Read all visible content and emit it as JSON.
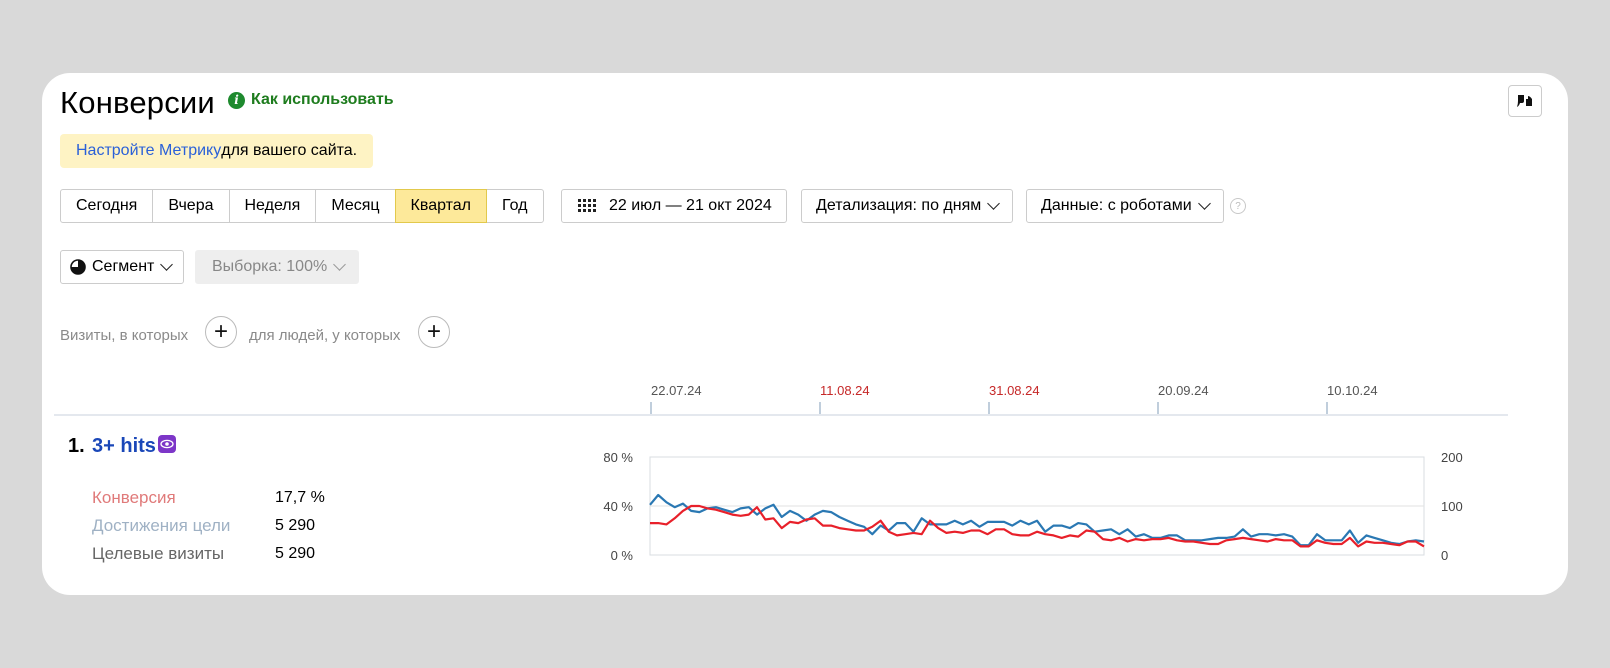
{
  "header": {
    "title": "Конверсии",
    "how_to_use": "Как использовать",
    "info_glyph": "i"
  },
  "notice": {
    "link": "Настройте Метрику",
    "text": " для вашего сайта."
  },
  "periods": [
    {
      "label": "Сегодня",
      "active": false
    },
    {
      "label": "Вчера",
      "active": false
    },
    {
      "label": "Неделя",
      "active": false
    },
    {
      "label": "Месяц",
      "active": false
    },
    {
      "label": "Квартал",
      "active": true
    },
    {
      "label": "Год",
      "active": false
    }
  ],
  "date_range": "22 июл — 21 окт 2024",
  "detail_label": "Детализация: по дням",
  "data_label": "Данные: с роботами",
  "help_glyph": "?",
  "segment_label": "Сегмент",
  "sample_label": "Выборка: 100%",
  "conditions": {
    "visits": "Визиты, в которых",
    "people": "для людей, у которых",
    "plus_glyph": "+"
  },
  "goal": {
    "number": "1.",
    "name": "3+ hits",
    "metrics": [
      {
        "label": "Конверсия",
        "value": "17,7 %",
        "color": "#e07a7a"
      },
      {
        "label": "Достижения цели",
        "value": "5 290",
        "color": "#9fb1c4"
      },
      {
        "label": "Целевые визиты",
        "value": "5 290",
        "color": "#666666"
      }
    ]
  },
  "colors": {
    "blue_series": "#2a78b3",
    "red_series": "#e8202a",
    "weekend_tick": "#c62828"
  },
  "chart_data": {
    "type": "line",
    "x_ticks": [
      {
        "label": "22.07.24",
        "weekend": false
      },
      {
        "label": "11.08.24",
        "weekend": true
      },
      {
        "label": "31.08.24",
        "weekend": true
      },
      {
        "label": "20.09.24",
        "weekend": false
      },
      {
        "label": "10.10.24",
        "weekend": false
      }
    ],
    "left_axis": {
      "ticks": [
        "80 %",
        "40 %",
        "0 %"
      ],
      "range": [
        0,
        80
      ]
    },
    "right_axis": {
      "ticks": [
        "200",
        "100",
        "0"
      ],
      "range": [
        0,
        200
      ]
    },
    "series": [
      {
        "color": "blue",
        "axis": "left",
        "values": [
          41,
          49,
          43,
          39,
          42,
          36,
          35,
          38,
          39,
          37,
          35,
          38,
          39,
          33,
          38,
          41,
          31,
          36,
          33,
          28,
          33,
          36,
          35,
          31,
          28,
          25,
          23,
          17,
          24,
          20,
          26,
          26,
          19,
          30,
          25,
          25,
          25,
          28,
          25,
          28,
          23,
          27,
          27,
          27,
          24,
          28,
          25,
          28,
          19,
          24,
          24,
          22,
          26,
          25,
          19,
          20,
          21,
          17,
          21,
          15,
          17,
          14,
          14,
          16,
          16,
          12,
          12,
          12,
          13,
          14,
          14,
          15,
          21,
          15,
          17,
          17,
          16,
          17,
          15,
          8,
          8,
          17,
          12,
          12,
          12,
          20,
          10,
          16,
          14,
          12,
          10,
          9,
          11,
          12,
          11
        ]
      },
      {
        "color": "red",
        "axis": "left",
        "values": [
          26,
          26,
          25,
          30,
          36,
          40,
          40,
          38,
          37,
          35,
          33,
          32,
          33,
          39,
          29,
          30,
          22,
          27,
          26,
          29,
          30,
          24,
          24,
          22,
          21,
          20,
          20,
          23,
          28,
          19,
          16,
          17,
          18,
          17,
          28,
          22,
          18,
          19,
          18,
          20,
          20,
          17,
          21,
          21,
          17,
          16,
          16,
          19,
          17,
          16,
          14,
          16,
          15,
          20,
          19,
          13,
          12,
          14,
          11,
          13,
          12,
          13,
          13,
          14,
          12,
          11,
          11,
          10,
          9,
          9,
          12,
          13,
          14,
          13,
          12,
          11,
          13,
          12,
          12,
          7,
          7,
          12,
          10,
          9,
          9,
          14,
          7,
          11,
          10,
          10,
          9,
          8,
          11,
          11,
          7
        ]
      }
    ]
  }
}
